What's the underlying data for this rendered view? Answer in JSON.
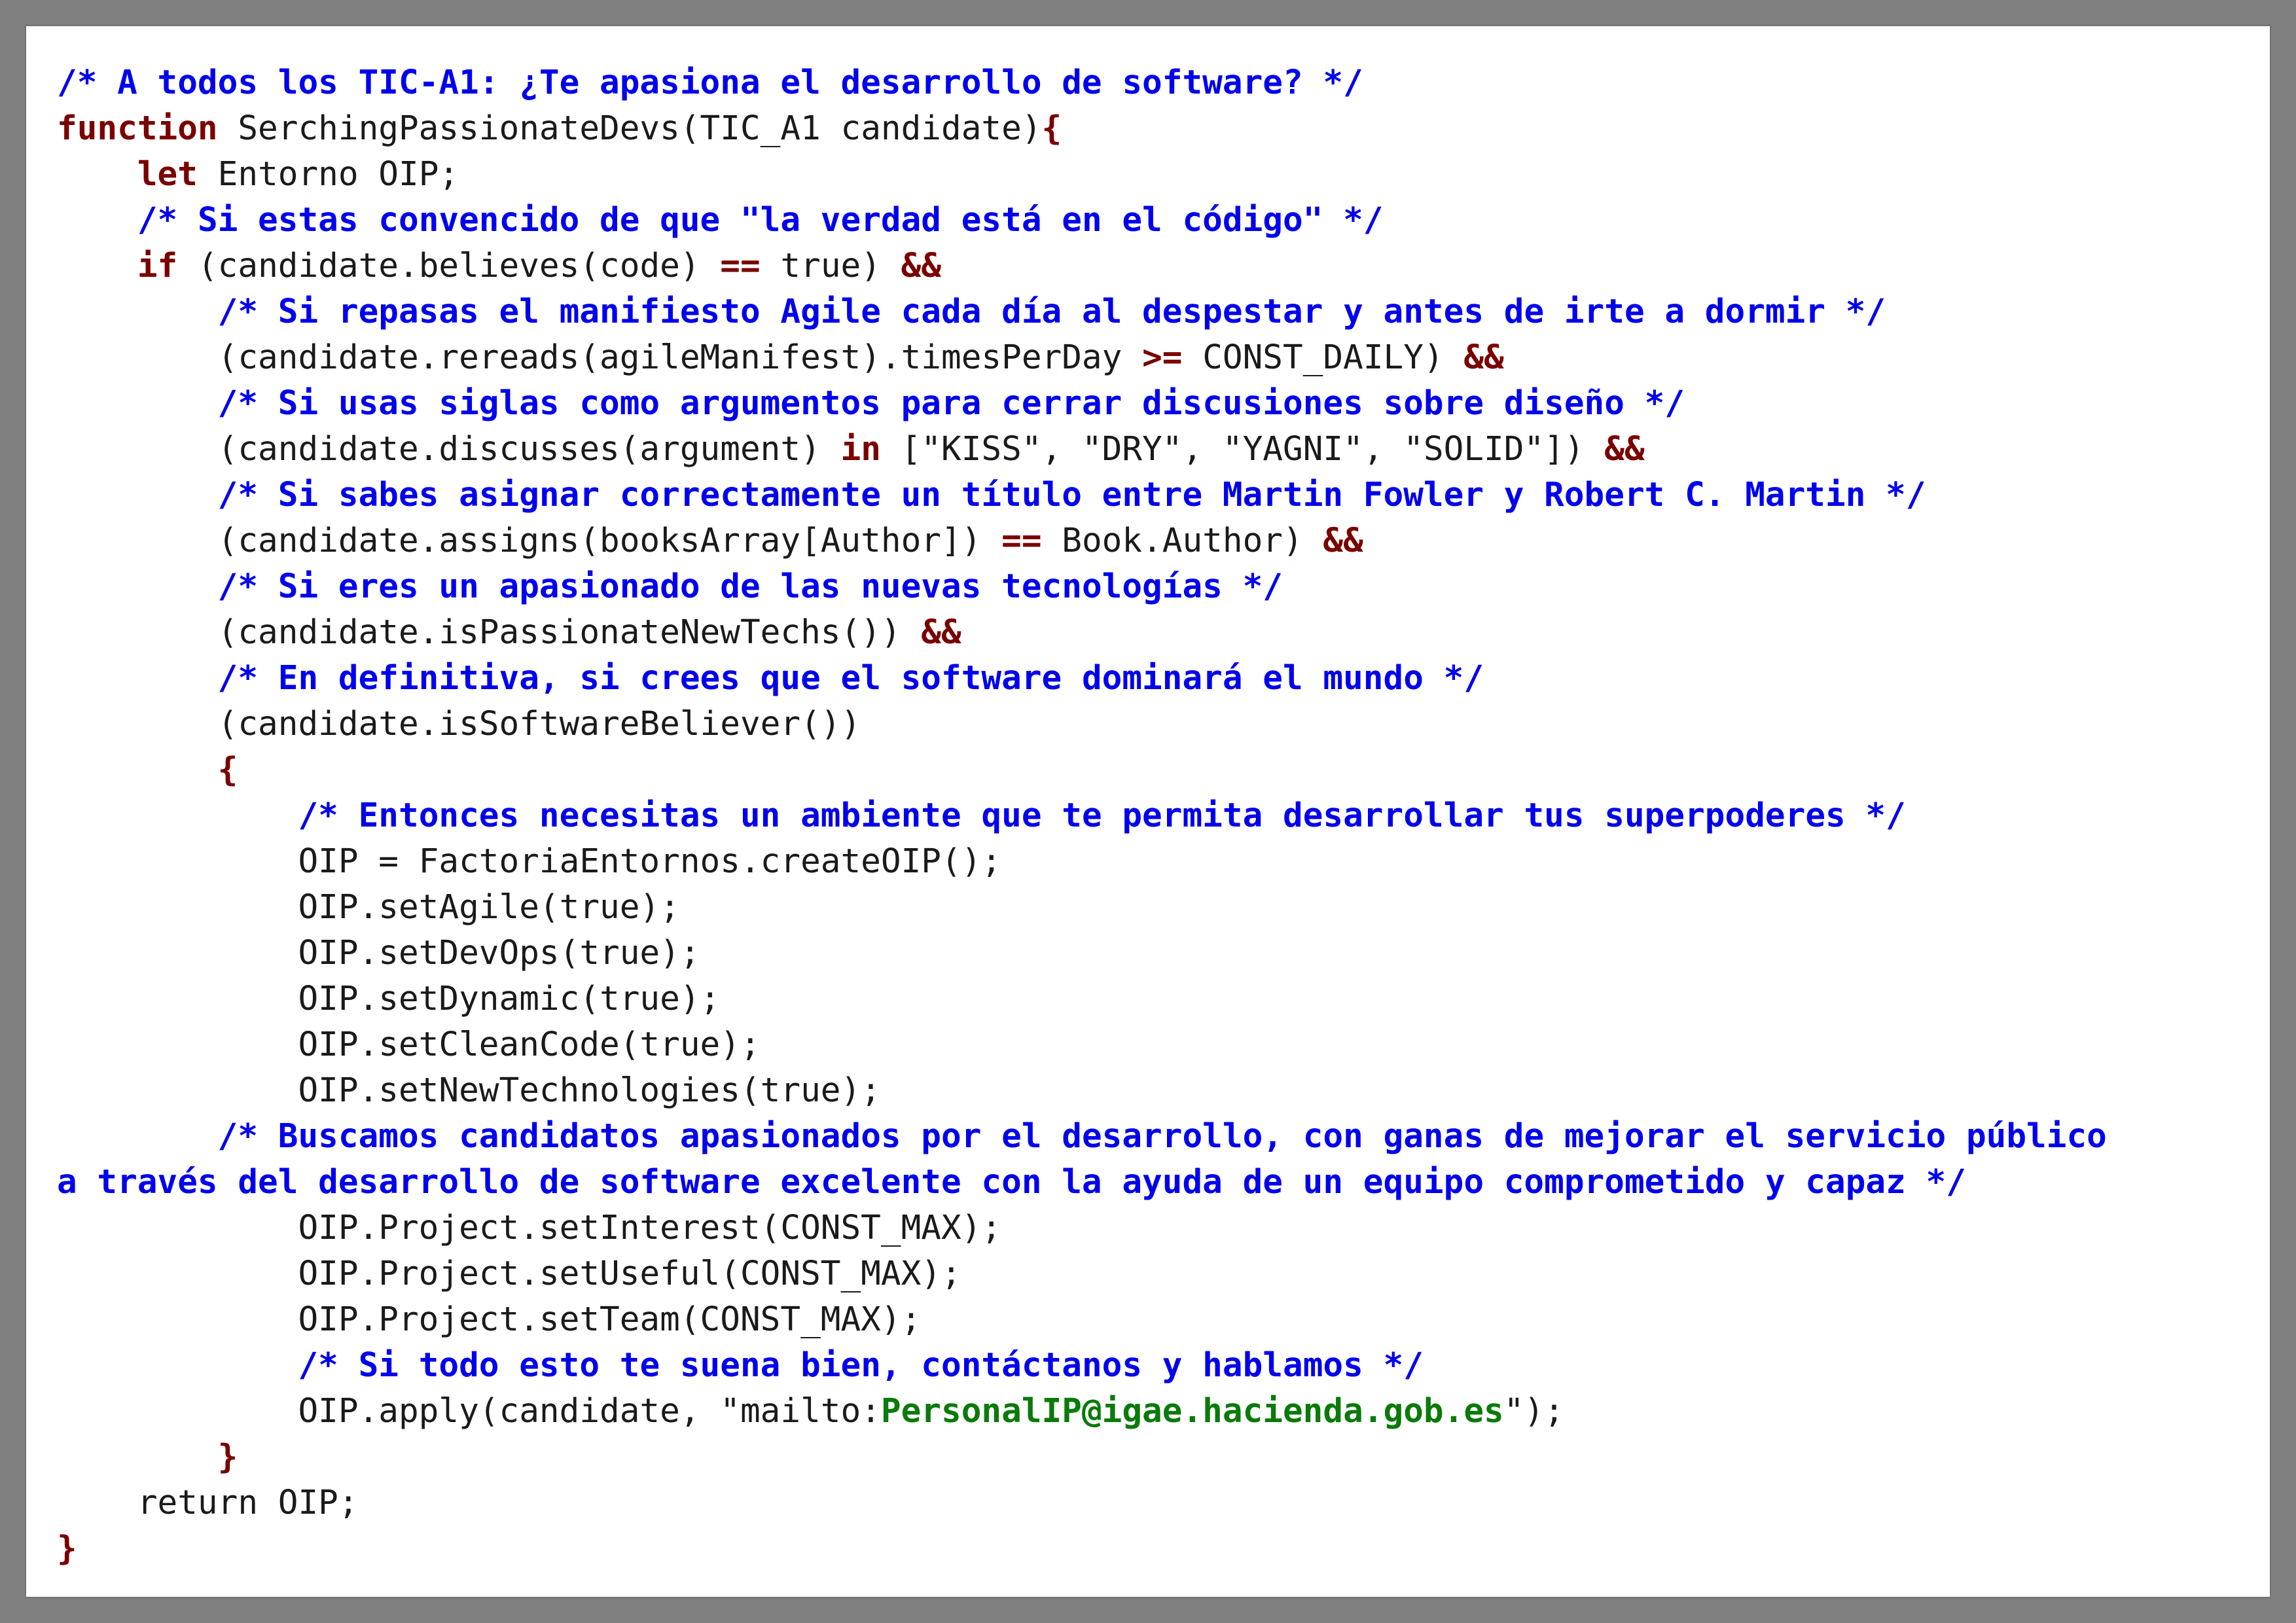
{
  "lines": [
    [
      {
        "t": "cm",
        "v": "/* A todos los TIC-A1: ¿Te apasiona el desarrollo de software? */"
      }
    ],
    [
      {
        "t": "kw",
        "v": "function"
      },
      {
        "t": "tx",
        "v": " SerchingPassionateDevs(TIC_A1 candidate)"
      },
      {
        "t": "op",
        "v": "{"
      }
    ],
    [
      {
        "t": "tx",
        "v": "    "
      },
      {
        "t": "kw",
        "v": "let"
      },
      {
        "t": "tx",
        "v": " Entorno OIP;"
      }
    ],
    [
      {
        "t": "tx",
        "v": "    "
      },
      {
        "t": "cm",
        "v": "/* Si estas convencido de que \"la verdad está en el código\" */"
      }
    ],
    [
      {
        "t": "tx",
        "v": "    "
      },
      {
        "t": "kw",
        "v": "if"
      },
      {
        "t": "tx",
        "v": " (candidate.believes(code) "
      },
      {
        "t": "op",
        "v": "=="
      },
      {
        "t": "tx",
        "v": " true) "
      },
      {
        "t": "op",
        "v": "&&"
      }
    ],
    [
      {
        "t": "tx",
        "v": "        "
      },
      {
        "t": "cm",
        "v": "/* Si repasas el manifiesto Agile cada día al despestar y antes de irte a dormir */"
      }
    ],
    [
      {
        "t": "tx",
        "v": "        (candidate.rereads(agileManifest).timesPerDay "
      },
      {
        "t": "op",
        "v": ">="
      },
      {
        "t": "tx",
        "v": " CONST_DAILY) "
      },
      {
        "t": "op",
        "v": "&&"
      }
    ],
    [
      {
        "t": "tx",
        "v": "        "
      },
      {
        "t": "cm",
        "v": "/* Si usas siglas como argumentos para cerrar discusiones sobre diseño */"
      }
    ],
    [
      {
        "t": "tx",
        "v": "        (candidate.discusses(argument) "
      },
      {
        "t": "kw",
        "v": "in"
      },
      {
        "t": "tx",
        "v": " [\"KISS\", \"DRY\", \"YAGNI\", \"SOLID\"]) "
      },
      {
        "t": "op",
        "v": "&&"
      }
    ],
    [
      {
        "t": "tx",
        "v": "        "
      },
      {
        "t": "cm",
        "v": "/* Si sabes asignar correctamente un título entre Martin Fowler y Robert C. Martin */"
      }
    ],
    [
      {
        "t": "tx",
        "v": "        (candidate.assigns(booksArray[Author]) "
      },
      {
        "t": "op",
        "v": "=="
      },
      {
        "t": "tx",
        "v": " Book.Author) "
      },
      {
        "t": "op",
        "v": "&&"
      }
    ],
    [
      {
        "t": "tx",
        "v": "        "
      },
      {
        "t": "cm",
        "v": "/* Si eres un apasionado de las nuevas tecnologías */"
      }
    ],
    [
      {
        "t": "tx",
        "v": "        (candidate.isPassionateNewTechs()) "
      },
      {
        "t": "op",
        "v": "&&"
      }
    ],
    [
      {
        "t": "tx",
        "v": "        "
      },
      {
        "t": "cm",
        "v": "/* En definitiva, si crees que el software dominará el mundo */"
      }
    ],
    [
      {
        "t": "tx",
        "v": "        (candidate.isSoftwareBeliever())"
      }
    ],
    [
      {
        "t": "tx",
        "v": "        "
      },
      {
        "t": "op",
        "v": "{"
      }
    ],
    [
      {
        "t": "tx",
        "v": "            "
      },
      {
        "t": "cm",
        "v": "/* Entonces necesitas un ambiente que te permita desarrollar tus superpoderes */"
      }
    ],
    [
      {
        "t": "tx",
        "v": "            OIP = FactoriaEntornos.createOIP();"
      }
    ],
    [
      {
        "t": "tx",
        "v": "            OIP.setAgile(true);"
      }
    ],
    [
      {
        "t": "tx",
        "v": "            OIP.setDevOps(true);"
      }
    ],
    [
      {
        "t": "tx",
        "v": "            OIP.setDynamic(true);"
      }
    ],
    [
      {
        "t": "tx",
        "v": "            OIP.setCleanCode(true);"
      }
    ],
    [
      {
        "t": "tx",
        "v": "            OIP.setNewTechnologies(true);"
      }
    ],
    [
      {
        "t": "tx",
        "v": "        "
      },
      {
        "t": "cm",
        "v": "/* Buscamos candidatos apasionados por el desarrollo, con ganas de mejorar el servicio público"
      }
    ],
    [
      {
        "t": "cm",
        "v": "a través del desarrollo de software excelente con la ayuda de un equipo comprometido y capaz */"
      }
    ],
    [
      {
        "t": "tx",
        "v": "            OIP.Project.setInterest(CONST_MAX);"
      }
    ],
    [
      {
        "t": "tx",
        "v": "            OIP.Project.setUseful(CONST_MAX);"
      }
    ],
    [
      {
        "t": "tx",
        "v": "            OIP.Project.setTeam(CONST_MAX);"
      }
    ],
    [
      {
        "t": "tx",
        "v": "            "
      },
      {
        "t": "cm",
        "v": "/* Si todo esto te suena bien, contáctanos y hablamos */"
      }
    ],
    [
      {
        "t": "tx",
        "v": "            OIP.apply(candidate, \"mailto:"
      },
      {
        "t": "mail",
        "v": "PersonalIP@igae.hacienda.gob.es"
      },
      {
        "t": "tx",
        "v": "\");"
      }
    ],
    [
      {
        "t": "tx",
        "v": "        "
      },
      {
        "t": "op",
        "v": "}"
      }
    ],
    [
      {
        "t": "tx",
        "v": "    return OIP;"
      }
    ],
    [
      {
        "t": "op",
        "v": "}"
      }
    ]
  ],
  "colors": {
    "background": "#808080",
    "page": "#ffffff",
    "text": "#1a1a1a",
    "comment": "#0000ee",
    "keyword": "#7a0000",
    "link": "#0a7a0a"
  }
}
